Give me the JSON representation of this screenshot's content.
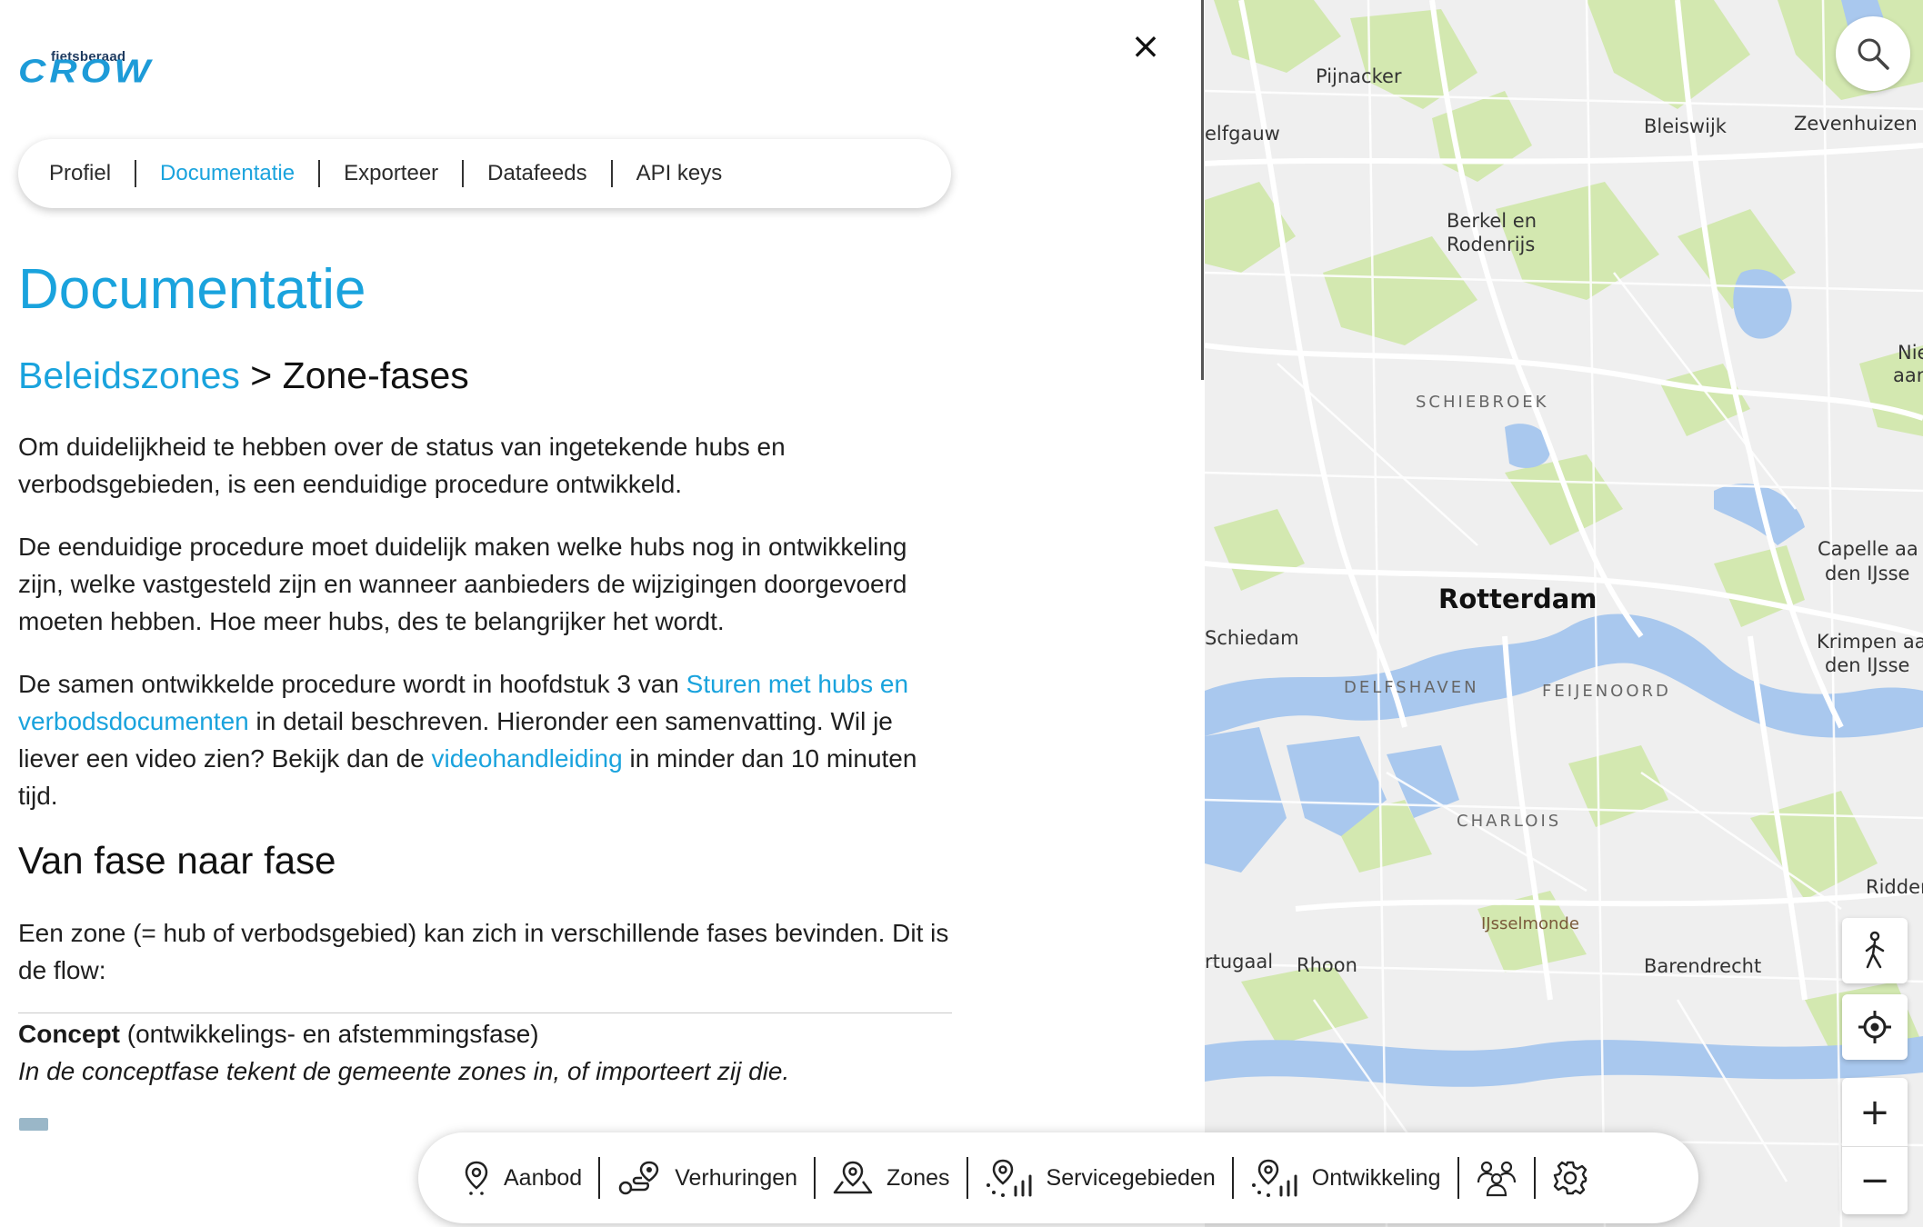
{
  "logo": {
    "small_text": "fietsberaad",
    "big_text": "CROW"
  },
  "tabs": [
    {
      "label": "Profiel",
      "active": false
    },
    {
      "label": "Documentatie",
      "active": true
    },
    {
      "label": "Exporteer",
      "active": false
    },
    {
      "label": "Datafeeds",
      "active": false
    },
    {
      "label": "API keys",
      "active": false
    }
  ],
  "doc": {
    "title": "Documentatie",
    "breadcrumb": {
      "parent": "Beleidszones",
      "separator": ">",
      "current": "Zone-fases"
    },
    "p1": "Om duidelijkheid te hebben over de status van ingetekende hubs en verbodsgebieden, is een eenduidige procedure ontwikkeld.",
    "p2": "De eenduidige procedure moet duidelijk maken welke hubs nog in ontwikkeling zijn, welke vastgesteld zijn en wanneer aanbieders de wijzigingen doorgevoerd moeten hebben. Hoe meer hubs, des te belangrijker het wordt.",
    "p3": {
      "part1": "De samen ontwikkelde procedure wordt in hoofdstuk 3 van ",
      "link1": "Sturen met hubs en verbodsdocumenten",
      "part2": " in detail beschreven. Hieronder een samenvatting. Wil je liever een video zien? Bekijk dan de ",
      "link2": "videohandleiding",
      "part3": " in minder dan 10 minuten tijd."
    },
    "heading_flow": "Van fase naar fase",
    "p4": "Een zone (= hub of verbodsgebied) kan zich in verschillende fases bevinden. Dit is de flow:",
    "concept_label": "Concept",
    "concept_sub": " (ontwikkelings- en afstemmingsfase)",
    "concept_desc": "In de conceptfase tekent de gemeente zones in, of importeert zij die."
  },
  "map": {
    "places": [
      {
        "id": "pijnacker",
        "label": "Pijnacker",
        "kind": "town"
      },
      {
        "id": "delfgauw",
        "label": "elfgauw",
        "kind": "town"
      },
      {
        "id": "bleiswijk",
        "label": "Bleiswijk",
        "kind": "town"
      },
      {
        "id": "zevenhuizen",
        "label": "Zevenhuizen",
        "kind": "town"
      },
      {
        "id": "berkel",
        "label": "Berkel en",
        "kind": "town"
      },
      {
        "id": "rodenrijs",
        "label": "Rodenrijs",
        "kind": "town"
      },
      {
        "id": "nie",
        "label": "Nie",
        "kind": "town"
      },
      {
        "id": "aan",
        "label": "aan",
        "kind": "town"
      },
      {
        "id": "schiebroek",
        "label": "SCHIEBROEK",
        "kind": "district"
      },
      {
        "id": "capelle1",
        "label": "Capelle aa",
        "kind": "town"
      },
      {
        "id": "capelle2",
        "label": "den IJsse",
        "kind": "town"
      },
      {
        "id": "rotterdam",
        "label": "Rotterdam",
        "kind": "city"
      },
      {
        "id": "schiedam",
        "label": "Schiedam",
        "kind": "town"
      },
      {
        "id": "krimpen1",
        "label": "Krimpen aa",
        "kind": "town"
      },
      {
        "id": "krimpen2",
        "label": "den IJsse",
        "kind": "town"
      },
      {
        "id": "delfshaven",
        "label": "DELFSHAVEN",
        "kind": "district"
      },
      {
        "id": "feijenoord",
        "label": "FEIJENOORD",
        "kind": "district"
      },
      {
        "id": "charlois",
        "label": "CHARLOIS",
        "kind": "district"
      },
      {
        "id": "ridder",
        "label": "Ridder",
        "kind": "town"
      },
      {
        "id": "ijsselmonde",
        "label": "IJsselmonde",
        "kind": "small"
      },
      {
        "id": "portugaal",
        "label": "rtugaal",
        "kind": "town"
      },
      {
        "id": "rhoon",
        "label": "Rhoon",
        "kind": "town"
      },
      {
        "id": "barendrecht",
        "label": "Barendrecht",
        "kind": "town"
      }
    ],
    "controls": {
      "search": "search-icon",
      "streetview": "pedestrian-icon",
      "locate": "locate-icon",
      "zoom_in": "+",
      "zoom_out": "−"
    },
    "colors": {
      "water": "#a9c8ee",
      "green": "#d3e8b0",
      "land": "#efefef",
      "road": "#ffffff"
    }
  },
  "bottom_nav": [
    {
      "label": "Aanbod",
      "icon": "map-pin-icon"
    },
    {
      "label": "Verhuringen",
      "icon": "route-icon"
    },
    {
      "label": "Zones",
      "icon": "zone-pin-icon"
    },
    {
      "label": "Servicegebieden",
      "icon": "service-area-icon"
    },
    {
      "label": "Ontwikkeling",
      "icon": "development-chart-icon"
    },
    {
      "label": "",
      "icon": "users-icon"
    },
    {
      "label": "",
      "icon": "settings-gear-icon"
    }
  ],
  "close_label": "×"
}
